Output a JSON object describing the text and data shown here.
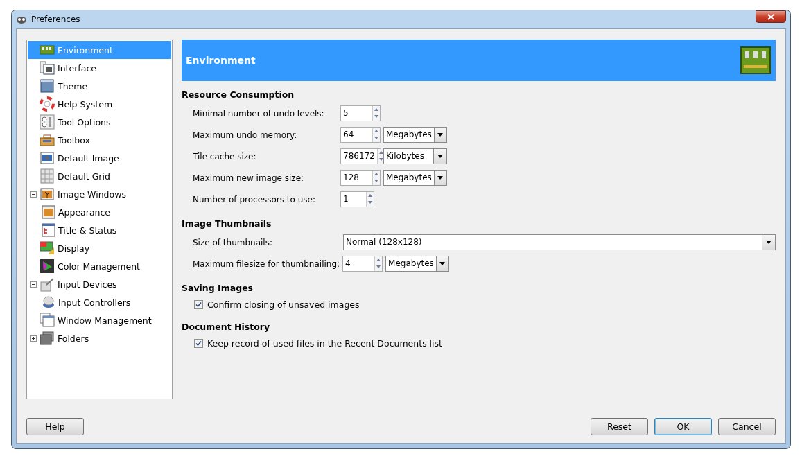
{
  "window": {
    "title": "Preferences"
  },
  "sidebar": {
    "items": [
      {
        "label": "Environment",
        "selected": true
      },
      {
        "label": "Interface",
        "selected": false
      },
      {
        "label": "Theme",
        "selected": false
      },
      {
        "label": "Help System",
        "selected": false
      },
      {
        "label": "Tool Options",
        "selected": false
      },
      {
        "label": "Toolbox",
        "selected": false
      },
      {
        "label": "Default Image",
        "selected": false
      },
      {
        "label": "Default Grid",
        "selected": false
      },
      {
        "label": "Image Windows",
        "selected": false,
        "expanded": true,
        "children": [
          {
            "label": "Appearance",
            "selected": false
          },
          {
            "label": "Title & Status",
            "selected": false
          }
        ]
      },
      {
        "label": "Display",
        "selected": false
      },
      {
        "label": "Color Management",
        "selected": false
      },
      {
        "label": "Input Devices",
        "selected": false,
        "expanded": true,
        "children": [
          {
            "label": "Input Controllers",
            "selected": false
          }
        ]
      },
      {
        "label": "Window Management",
        "selected": false
      },
      {
        "label": "Folders",
        "selected": false,
        "expanded": false
      }
    ]
  },
  "banner": {
    "title": "Environment"
  },
  "sections": [
    {
      "title": "Resource Consumption",
      "rows": [
        {
          "kind": "spin",
          "label": "Minimal number of undo levels:",
          "value": "5"
        },
        {
          "kind": "spin",
          "label": "Maximum undo memory:",
          "value": "64",
          "unit": "Megabytes"
        },
        {
          "kind": "spin",
          "label": "Tile cache size:",
          "value": "786172",
          "unit": "Kilobytes"
        },
        {
          "kind": "spin",
          "label": "Maximum new image size:",
          "value": "128",
          "unit": "Megabytes"
        },
        {
          "kind": "spin_small",
          "label": "Number of processors to use:",
          "value": "1"
        }
      ]
    },
    {
      "title": "Image Thumbnails",
      "rows": [
        {
          "kind": "combo",
          "label": "Size of thumbnails:",
          "value": "Normal (128x128)"
        },
        {
          "kind": "spin",
          "label": "Maximum filesize for thumbnailing:",
          "value": "4",
          "unit": "Megabytes"
        }
      ]
    },
    {
      "title": "Saving Images",
      "rows": [
        {
          "kind": "check",
          "label": "Confirm closing of unsaved images",
          "checked": true
        }
      ]
    },
    {
      "title": "Document History",
      "rows": [
        {
          "kind": "check",
          "label": "Keep record of used files in the Recent Documents list",
          "checked": true
        }
      ]
    }
  ],
  "buttons_left": [
    "Help"
  ],
  "buttons_right": [
    {
      "label": "Reset",
      "default": false
    },
    {
      "label": "OK",
      "default": true
    },
    {
      "label": "Cancel",
      "default": false
    }
  ]
}
